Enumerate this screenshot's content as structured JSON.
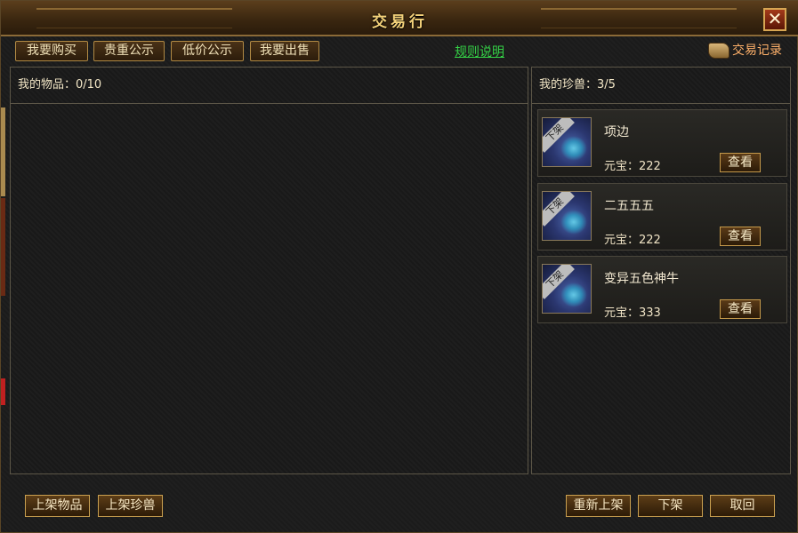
{
  "window": {
    "title": "交易行",
    "close_label": "✕"
  },
  "tabs": [
    {
      "label": "我要购买"
    },
    {
      "label": "贵重公示"
    },
    {
      "label": "低价公示"
    },
    {
      "label": "我要出售"
    }
  ],
  "rules_link": "规则说明",
  "trade_log_label": "交易记录",
  "items_panel": {
    "label": "我的物品：0/10"
  },
  "pets_panel": {
    "label": "我的珍兽：3/5"
  },
  "pets": [
    {
      "name": "项边",
      "price": "元宝：222",
      "view_label": "查看",
      "badge": "下架"
    },
    {
      "name": "二五五五",
      "price": "元宝：222",
      "view_label": "查看",
      "badge": "下架"
    },
    {
      "name": "变异五色神牛",
      "price": "元宝：333",
      "view_label": "查看",
      "badge": "下架"
    }
  ],
  "buttons": {
    "list_item": "上架物品",
    "list_pet": "上架珍兽",
    "relist": "重新上架",
    "delist": "下架",
    "cancel": "取回"
  },
  "colors": {
    "title": "#f4d27a",
    "rules_link": "#34d146",
    "trade_log": "#ffb16a"
  }
}
